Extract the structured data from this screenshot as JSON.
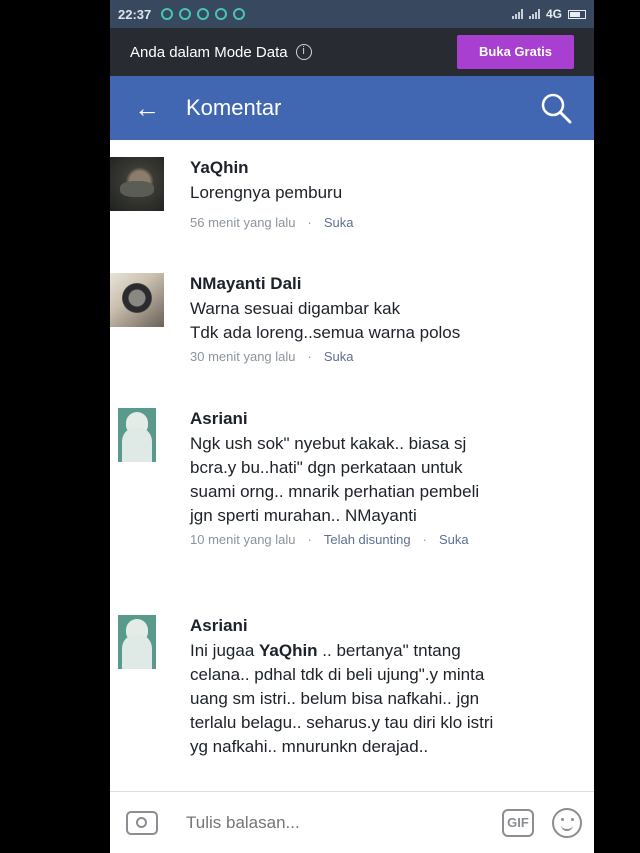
{
  "status_bar": {
    "time": "22:37",
    "network": "4G"
  },
  "data_mode_bar": {
    "text": "Anda dalam Mode Data",
    "info_icon": "i",
    "button_label": "Buka Gratis"
  },
  "header": {
    "back_icon": "←",
    "title": "Komentar"
  },
  "comments": [
    {
      "author": "YaQhin",
      "text": "Lorengnya pemburu",
      "time": "56 menit yang lalu",
      "like": "Suka"
    },
    {
      "author": "NMayanti Dali",
      "text": "Warna sesuai digambar kak\nTdk ada loreng..semua warna polos",
      "time": "30 menit yang lalu",
      "like": "Suka"
    },
    {
      "author": "Asriani",
      "text": "Ngk ush sok\" nyebut kakak.. biasa sj bcra.y bu..hati\" dgn perkataan untuk suami orng.. mnarik perhatian pembeli jgn sperti murahan.. NMayanti",
      "time": "10 menit yang lalu",
      "edited": "Telah disunting",
      "like": "Suka"
    },
    {
      "author": "Asriani",
      "text_before": "Ini jugaa ",
      "mention": "YaQhin",
      "text_after": " .. bertanya\" tntang celana.. pdhal tdk di beli ujung\".y minta uang sm istri.. belum bisa nafkahi.. jgn terlalu belagu.. seharus.y tau diri klo istri yg nafkahi.. mnurunkn derajad.."
    }
  ],
  "meta_separator": "·",
  "composer": {
    "placeholder": "Tulis balasan...",
    "gif_label": "GIF"
  }
}
